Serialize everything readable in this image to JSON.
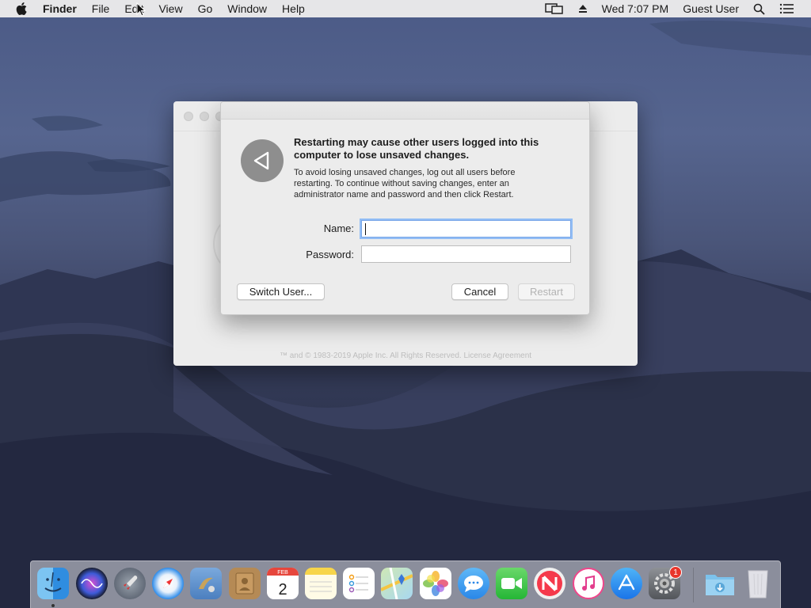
{
  "menubar": {
    "app_name": "Finder",
    "items": [
      "File",
      "Edit",
      "View",
      "Go",
      "Window",
      "Help"
    ],
    "clock": "Wed 7:07 PM",
    "user": "Guest User",
    "status_icons": [
      "display-mirroring-icon",
      "eject-icon",
      "spotlight-search-icon",
      "notification-center-icon"
    ]
  },
  "background_window": {
    "copyright": "™ and © 1983-2019 Apple Inc. All Rights Reserved. License Agreement"
  },
  "dialog": {
    "heading": "Restarting may cause other users logged into this computer to lose unsaved changes.",
    "message": "To avoid losing unsaved changes, log out all users before restarting. To continue without saving changes, enter an administrator name and password and then click Restart.",
    "name_label": "Name:",
    "name_value": "",
    "password_label": "Password:",
    "password_value": "",
    "switch_user_label": "Switch User...",
    "cancel_label": "Cancel",
    "restart_label": "Restart"
  },
  "dock": {
    "items": [
      {
        "name": "finder-icon",
        "running": true
      },
      {
        "name": "siri-icon"
      },
      {
        "name": "launchpad-icon"
      },
      {
        "name": "safari-icon"
      },
      {
        "name": "mail-icon"
      },
      {
        "name": "contacts-icon"
      },
      {
        "name": "calendar-icon",
        "month": "FEB",
        "day": "2"
      },
      {
        "name": "notes-icon"
      },
      {
        "name": "reminders-icon"
      },
      {
        "name": "maps-icon"
      },
      {
        "name": "photos-icon"
      },
      {
        "name": "messages-icon"
      },
      {
        "name": "facetime-icon"
      },
      {
        "name": "news-icon"
      },
      {
        "name": "itunes-icon"
      },
      {
        "name": "app-store-icon"
      },
      {
        "name": "system-preferences-icon",
        "badge": "1"
      },
      {
        "name": "downloads-folder-icon"
      },
      {
        "name": "trash-icon"
      }
    ]
  },
  "colors": {
    "focus_ring": "#92bdf5",
    "dialog_bg": "#ececec",
    "badge": "#e8352b"
  }
}
